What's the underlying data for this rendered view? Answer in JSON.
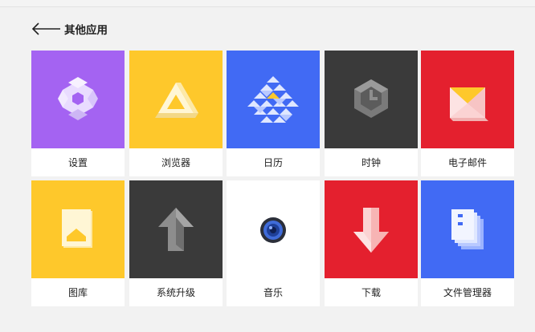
{
  "header": {
    "title": "其他应用"
  },
  "apps": [
    {
      "label": "设置",
      "color": "#a463f2"
    },
    {
      "label": "浏览器",
      "color": "#fec82b"
    },
    {
      "label": "日历",
      "color": "#416af4"
    },
    {
      "label": "时钟",
      "color": "#3a3a3a"
    },
    {
      "label": "电子邮件",
      "color": "#e4202e"
    },
    {
      "label": "图库",
      "color": "#fec82b"
    },
    {
      "label": "系统升级",
      "color": "#3a3a3a"
    },
    {
      "label": "音乐",
      "color": "#ffffff"
    },
    {
      "label": "下载",
      "color": "#e4202e"
    },
    {
      "label": "文件管理器",
      "color": "#416af4"
    }
  ],
  "icons": [
    "gear-icon",
    "triangle-icon",
    "calendar-icon",
    "clock-icon",
    "mail-icon",
    "gallery-icon",
    "upgrade-arrow-icon",
    "speaker-icon",
    "download-arrow-icon",
    "folder-icon"
  ]
}
